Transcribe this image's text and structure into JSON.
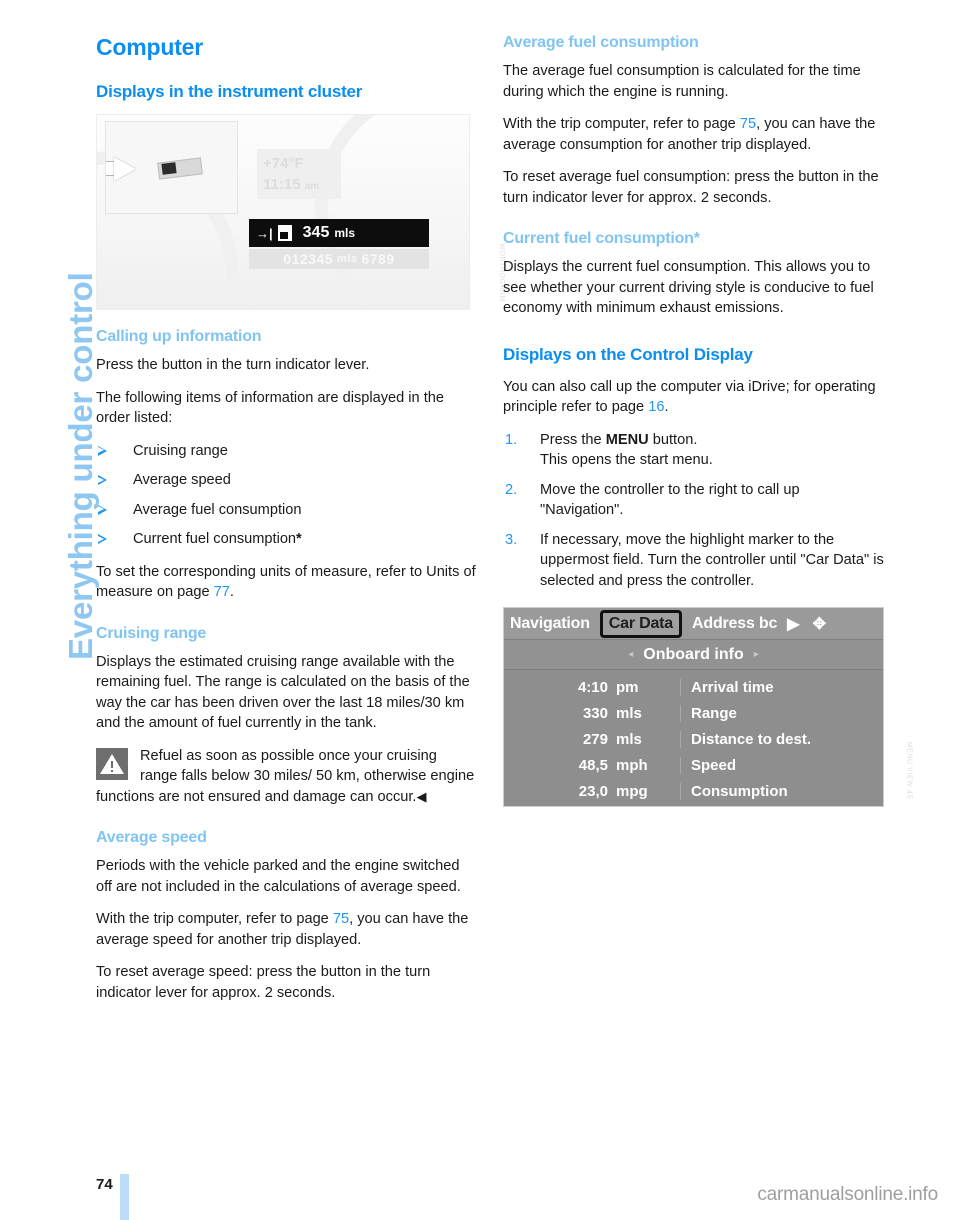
{
  "chapter_tab": {
    "label": "Everything under control"
  },
  "page": {
    "number": "74",
    "watermark": "carmanualsonline.info"
  },
  "left_column": {
    "title": "Computer",
    "section_cluster": {
      "heading": "Displays in the instrument cluster",
      "figure": {
        "code": "WORTHOGRAM",
        "temperature": "+74",
        "temperature_unit": "°F",
        "clock": "11:15",
        "clock_suffix": "am",
        "range_arrow": "→|",
        "range_value": "345",
        "range_unit": "mls",
        "odometer": "012345",
        "odometer_unit": "mls",
        "trip": "6789"
      }
    },
    "sub_calling": {
      "heading": "Calling up information",
      "p1": "Press the button in the turn indicator lever.",
      "p2": "The following items of information are displayed in the order listed:",
      "items": [
        "Cruising range",
        "Average speed",
        "Average fuel consumption",
        "Current fuel consumption"
      ],
      "item_last_star": "*",
      "p3_a": "To set the corresponding units of measure, refer to Units of measure on page ",
      "p3_page": "77",
      "p3_b": "."
    },
    "sub_cruising": {
      "heading": "Cruising range",
      "p1": "Displays the estimated cruising range available with the remaining fuel. The range is calculated on the basis of the way the car has been driven over the last 18 miles/30 km and the amount of fuel currently in the tank.",
      "warning": "Refuel as soon as possible once your cruising range falls below 30 miles/ 50 km, otherwise engine functions are not ensured and damage can occur.",
      "warning_end": "◀"
    },
    "sub_avgspeed": {
      "heading": "Average speed",
      "p1": "Periods with the vehicle parked and the engine switched off are not included in the calculations of average speed.",
      "p2_a": "With the trip computer, refer to page ",
      "p2_page": "75",
      "p2_b": ", you can have the average speed for another trip displayed.",
      "p3": "To reset average speed: press the button in the turn indicator lever for approx. 2 seconds."
    }
  },
  "right_column": {
    "sub_avgfuel": {
      "heading": "Average fuel consumption",
      "p1": "The average fuel consumption is calculated for the time during which the engine is running.",
      "p2_a": "With the trip computer, refer to page ",
      "p2_page": "75",
      "p2_b": ", you can have the average consumption for another trip displayed.",
      "p3": "To reset average fuel consumption: press the button in the turn indicator lever for approx. 2 seconds."
    },
    "sub_currentfuel": {
      "heading": "Current fuel consumption*",
      "p1": "Displays the current fuel consumption. This allows you to see whether your current driving style is conducive to fuel economy with minimum exhaust emissions."
    },
    "section_control_display": {
      "heading": "Displays on the Control Display",
      "p1_a": "You can also call up the computer via iDrive; for operating principle refer to page ",
      "p1_page": "16",
      "p1_b": ".",
      "steps": [
        {
          "num": "1.",
          "text_a": "Press the ",
          "bold": "MENU",
          "text_b": " button.",
          "text_c": "This opens the start menu."
        },
        {
          "num": "2.",
          "text_a": "Move the controller to the right to call up \"Navigation\".",
          "bold": "",
          "text_b": "",
          "text_c": ""
        },
        {
          "num": "3.",
          "text_a": "If necessary, move the highlight marker to the uppermost field. Turn the controller until \"Car Data\" is selected and press the controller.",
          "bold": "",
          "text_b": "",
          "text_c": ""
        }
      ],
      "figure": {
        "code": "MENU VIEW 45",
        "tabs": [
          "Navigation",
          "Car Data",
          "Address bc"
        ],
        "selected_tab": "Car Data",
        "forward_glyph": "▶",
        "compass_glyph": "✥",
        "subbar_left_caret": "◂",
        "subbar_title": "Onboard info",
        "subbar_right_caret": "▸",
        "rows": [
          {
            "value": "4:10",
            "unit": "pm",
            "label": "Arrival time"
          },
          {
            "value": "330",
            "unit": "mls",
            "label": "Range"
          },
          {
            "value": "279",
            "unit": "mls",
            "label": "Distance to dest."
          },
          {
            "value": "48,5",
            "unit": "mph",
            "label": "Speed"
          },
          {
            "value": "23,0",
            "unit": "mpg",
            "label": "Consumption"
          }
        ]
      }
    }
  }
}
